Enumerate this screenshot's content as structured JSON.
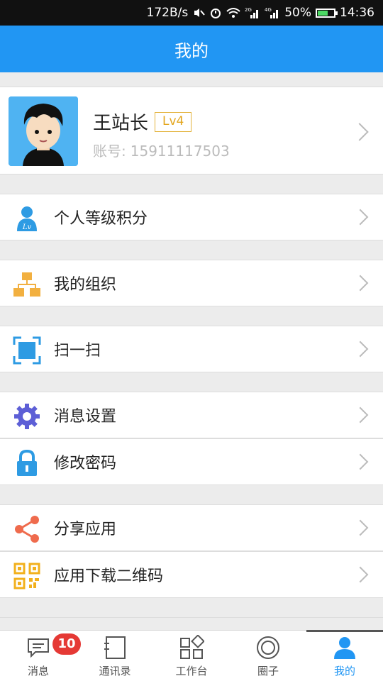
{
  "status_bar": {
    "network_speed": "172B/s",
    "battery": "50%",
    "time": "14:36",
    "icons": [
      "mute-icon",
      "alarm-icon",
      "wifi-icon",
      "signal-2g-icon",
      "signal-4g-icon",
      "battery-charging-icon"
    ]
  },
  "header": {
    "title": "我的"
  },
  "profile": {
    "name": "王站长",
    "level": "Lv4",
    "account_label": "账号:",
    "account_value": "15911117503"
  },
  "menu": [
    {
      "label": "个人等级积分",
      "icon": "user-level-icon",
      "color": "#2e9be3"
    },
    {
      "label": "我的组织",
      "icon": "organization-icon",
      "color": "#f2b040"
    },
    {
      "label": "扫一扫",
      "icon": "scan-icon",
      "color": "#2e9be3"
    },
    {
      "label": "消息设置",
      "icon": "gear-icon",
      "color": "#5d5fd6"
    },
    {
      "label": "修改密码",
      "icon": "lock-icon",
      "color": "#2e9be3"
    },
    {
      "label": "分享应用",
      "icon": "share-icon",
      "color": "#ef6b4d"
    },
    {
      "label": "应用下载二维码",
      "icon": "qrcode-icon",
      "color": "#f2b01c"
    }
  ],
  "tabbar": {
    "tabs": [
      {
        "label": "消息",
        "icon": "message-icon",
        "badge": "10"
      },
      {
        "label": "通讯录",
        "icon": "contacts-icon"
      },
      {
        "label": "工作台",
        "icon": "workbench-icon"
      },
      {
        "label": "圈子",
        "icon": "circle-icon"
      },
      {
        "label": "我的",
        "icon": "profile-icon",
        "active": true
      }
    ]
  },
  "colors": {
    "primary": "#2196f3",
    "badge": "#e53935",
    "level_badge": "#e3a51c"
  }
}
